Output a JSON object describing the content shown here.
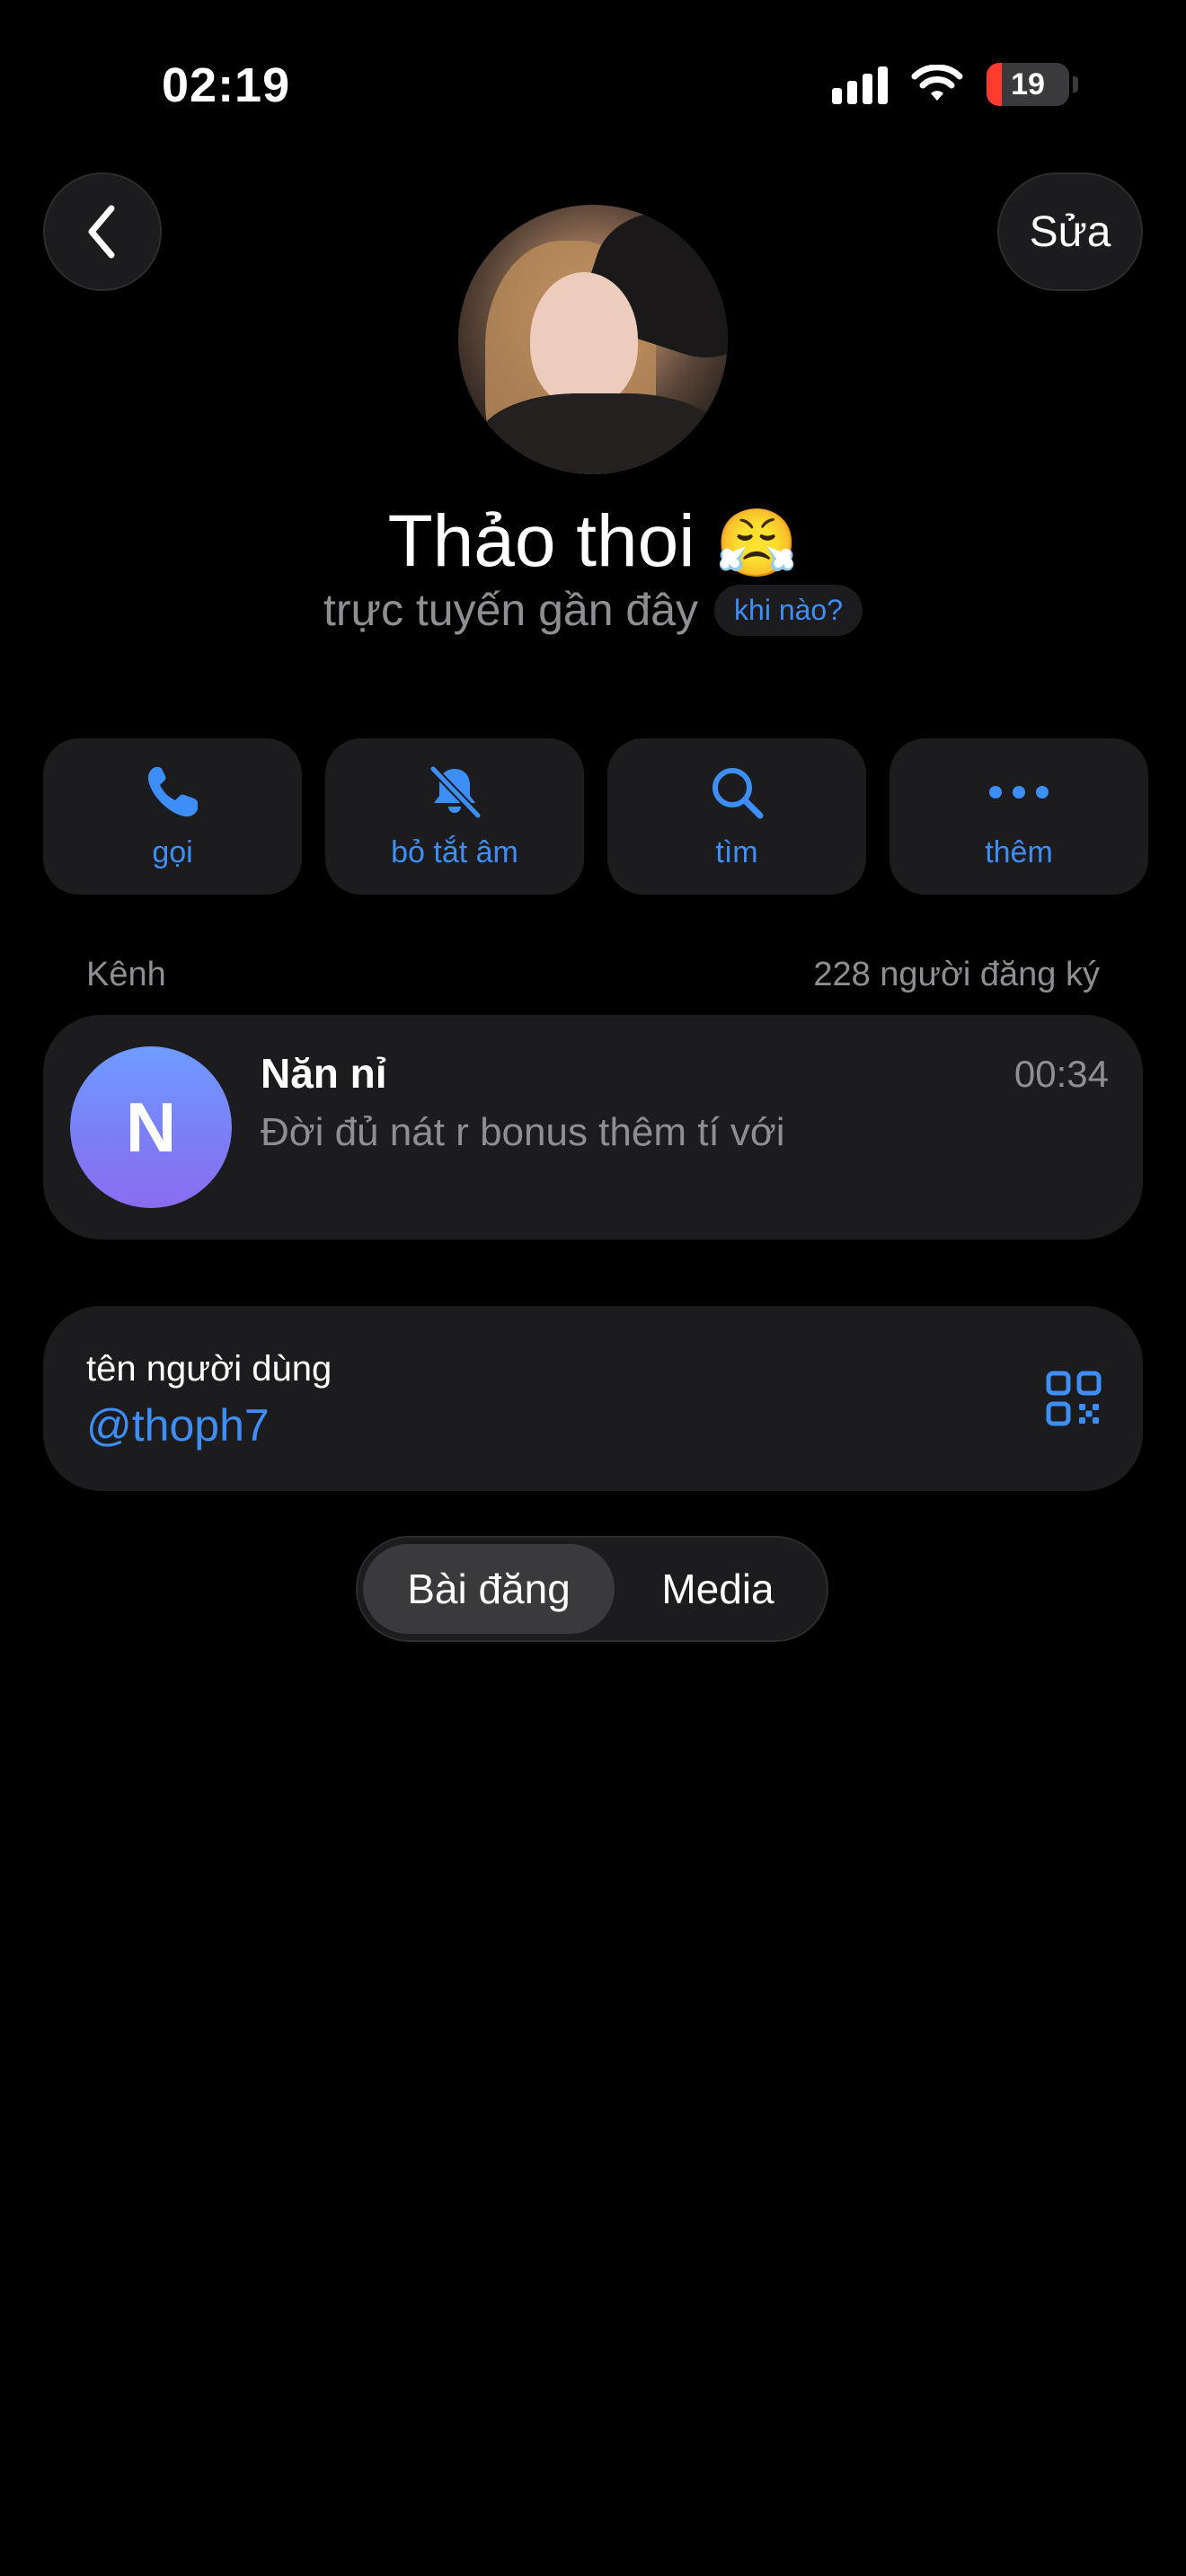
{
  "status_bar": {
    "time": "02:19",
    "battery_percent": "19",
    "battery_level": 0.19
  },
  "header": {
    "edit_label": "Sửa"
  },
  "profile": {
    "name": "Thảo thoi",
    "name_emoji": "😤",
    "status": "trực tuyến gần đây",
    "when_label": "khi nào?"
  },
  "actions": [
    {
      "label": "gọi",
      "icon": "phone-icon"
    },
    {
      "label": "bỏ tắt âm",
      "icon": "bell-slash-icon"
    },
    {
      "label": "tìm",
      "icon": "search-icon"
    },
    {
      "label": "thêm",
      "icon": "more-icon"
    }
  ],
  "channel": {
    "section_label": "Kênh",
    "subscribers": "228 người đăng ký",
    "avatar_letter": "N",
    "title": "Năn nỉ",
    "time": "00:34",
    "last_message": "Đời đủ nát r bonus thêm tí với"
  },
  "username": {
    "label": "tên người dùng",
    "handle": "@thoph7"
  },
  "tabs": [
    {
      "label": "Bài đăng",
      "active": true
    },
    {
      "label": "Media",
      "active": false
    }
  ],
  "colors": {
    "accent": "#3e8ef7",
    "background": "#000000",
    "card": "#1c1c1e",
    "secondary_text": "#8e8e93"
  }
}
